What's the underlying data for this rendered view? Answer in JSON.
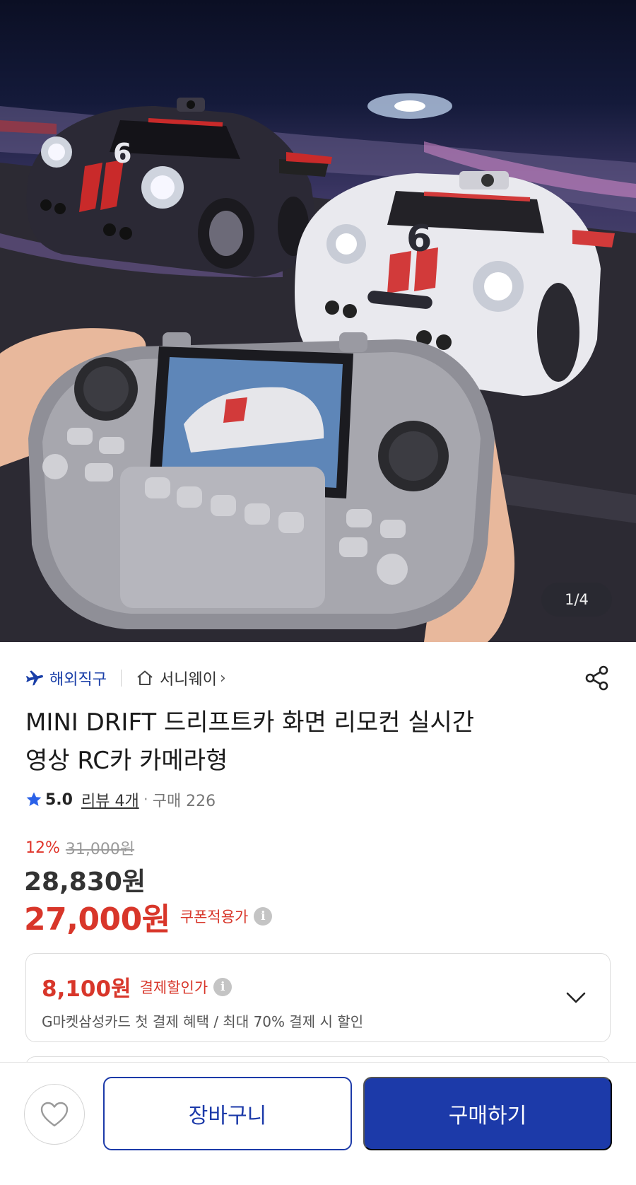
{
  "gallery": {
    "counter": "1/4"
  },
  "meta": {
    "global_tag": "해외직구",
    "store_name": "서니웨이",
    "store_chevron": "›"
  },
  "product": {
    "title_line1": "MINI DRIFT 드리프트카 화면 리모컨 실시간",
    "title_line2": "영상 RC카 카메라형"
  },
  "rating": {
    "score": "5.0",
    "review_label": "리뷰 4개",
    "separator": "·",
    "purchase_label": "구매 226"
  },
  "price": {
    "discount_rate": "12%",
    "original": "31,000원",
    "sale": "28,830원",
    "coupon_price": "27,000원",
    "coupon_label": "쿠폰적용가",
    "info_glyph": "i"
  },
  "payment_benefit": {
    "price": "8,100원",
    "label": "결제할인가",
    "description": "G마켓삼성카드 첫 결제 혜택 / 최대 70% 결제 시 할인"
  },
  "actions": {
    "cart_label": "장바구니",
    "buy_label": "구매하기"
  },
  "colors": {
    "primary": "#1c3aa9",
    "price_red": "#d8362a",
    "discount_red": "#e0352b"
  },
  "icons": [
    "airplane-icon",
    "store-home-icon",
    "share-icon",
    "star-icon",
    "info-icon",
    "chevron-down-icon",
    "heart-icon"
  ]
}
